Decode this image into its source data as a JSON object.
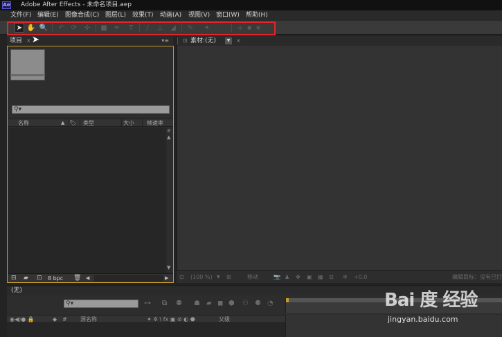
{
  "window": {
    "logo": "Ae",
    "title": "Adobe After Effects - 未命名项目.aep"
  },
  "menu": {
    "items": [
      "文件(F)",
      "编辑(E)",
      "图像合成(C)",
      "图层(L)",
      "效果(T)",
      "动画(A)",
      "视图(V)",
      "窗口(W)",
      "帮助(H)"
    ]
  },
  "toolbar": {
    "tools": [
      "selection-tool",
      "hand-tool",
      "zoom-tool",
      "rotation-tool",
      "camera-orbit-tool",
      "camera-pan-tool",
      "rectangle-mask-tool",
      "pen-tool",
      "type-tool",
      "brush-tool",
      "clone-stamp-tool",
      "eraser-tool",
      "roto-brush-tool",
      "puppet-pin-tool",
      "puppet-overlap-tool",
      "puppet-starch-tool"
    ],
    "glyphs": {
      "select": "➤",
      "hand": "✋",
      "zoom": "🔍",
      "rotate": "↶",
      "orbit": "⟳",
      "pan": "✣",
      "rect": "■",
      "pen": "✒",
      "type": "T",
      "brush": "/",
      "stamp": "⊥",
      "eraser": "◢",
      "roto": "✎",
      "pin1": "✦",
      "pin2": "●",
      "pin3": "✖"
    },
    "highlight_color": "#e0262a"
  },
  "project_panel": {
    "tab_label": "项目",
    "close_glyph": "×",
    "menu_glyph": "▾≡",
    "search_glyph": "⚲▾",
    "columns": [
      "名称",
      "类型",
      "大小",
      "帧速率"
    ],
    "sort_glyph": "▲",
    "tag_glyph": "🏷",
    "bpc_label": "8 bpc",
    "footer_icons": [
      "interpret-footage-icon",
      "new-folder-icon",
      "new-composition-icon",
      "trash-icon"
    ],
    "accent_color": "#c79a2a"
  },
  "footage_panel": {
    "tab_label": "素材:(无)",
    "dropdown_glyph": "▼",
    "close_glyph": "×",
    "footer": {
      "zoom": "(100 %)",
      "channel_dd": "▼",
      "transfer_label": "移动",
      "exposure_value": "+0.0",
      "edit_target": "编辑目标：没有已打"
    }
  },
  "timeline_panel": {
    "tab_label": "(无)",
    "search_glyph": "⚲▾",
    "columns": {
      "switches_left": "◉◀)● 🔒",
      "tag": "◆",
      "number": "#",
      "source_name": "源名称",
      "switches_right": "✦ ✲ \\ fx ▣ ⊘ ◐ ⬣",
      "parent": "父级"
    }
  },
  "watermark": {
    "logo": "Bai 度 经验",
    "url": "jingyan.baidu.com"
  }
}
